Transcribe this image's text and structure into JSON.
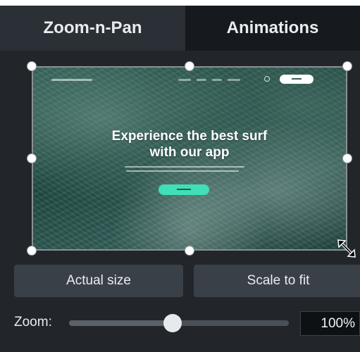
{
  "tabs": [
    {
      "label": "Zoom-n-Pan",
      "active": true
    },
    {
      "label": "Animations",
      "active": false
    }
  ],
  "preview": {
    "hero_title_line1": "Experience the best surf",
    "hero_title_line2": "with our app",
    "accent_color": "#3fe0b7"
  },
  "buttons": {
    "actual_size": "Actual size",
    "scale_to_fit": "Scale to fit"
  },
  "zoom": {
    "label": "Zoom:",
    "value_text": "100%",
    "slider_fraction": 0.47
  },
  "colors": {
    "panel_bg": "#22262b",
    "tab_active_bg": "#2b3036",
    "tab_inactive_bg": "#161a1e",
    "button_bg": "#3a4047",
    "text": "#e9edf0"
  },
  "icons": {
    "handle": "selection-handle-icon",
    "resize": "diagonal-resize-icon",
    "search": "search-icon"
  }
}
